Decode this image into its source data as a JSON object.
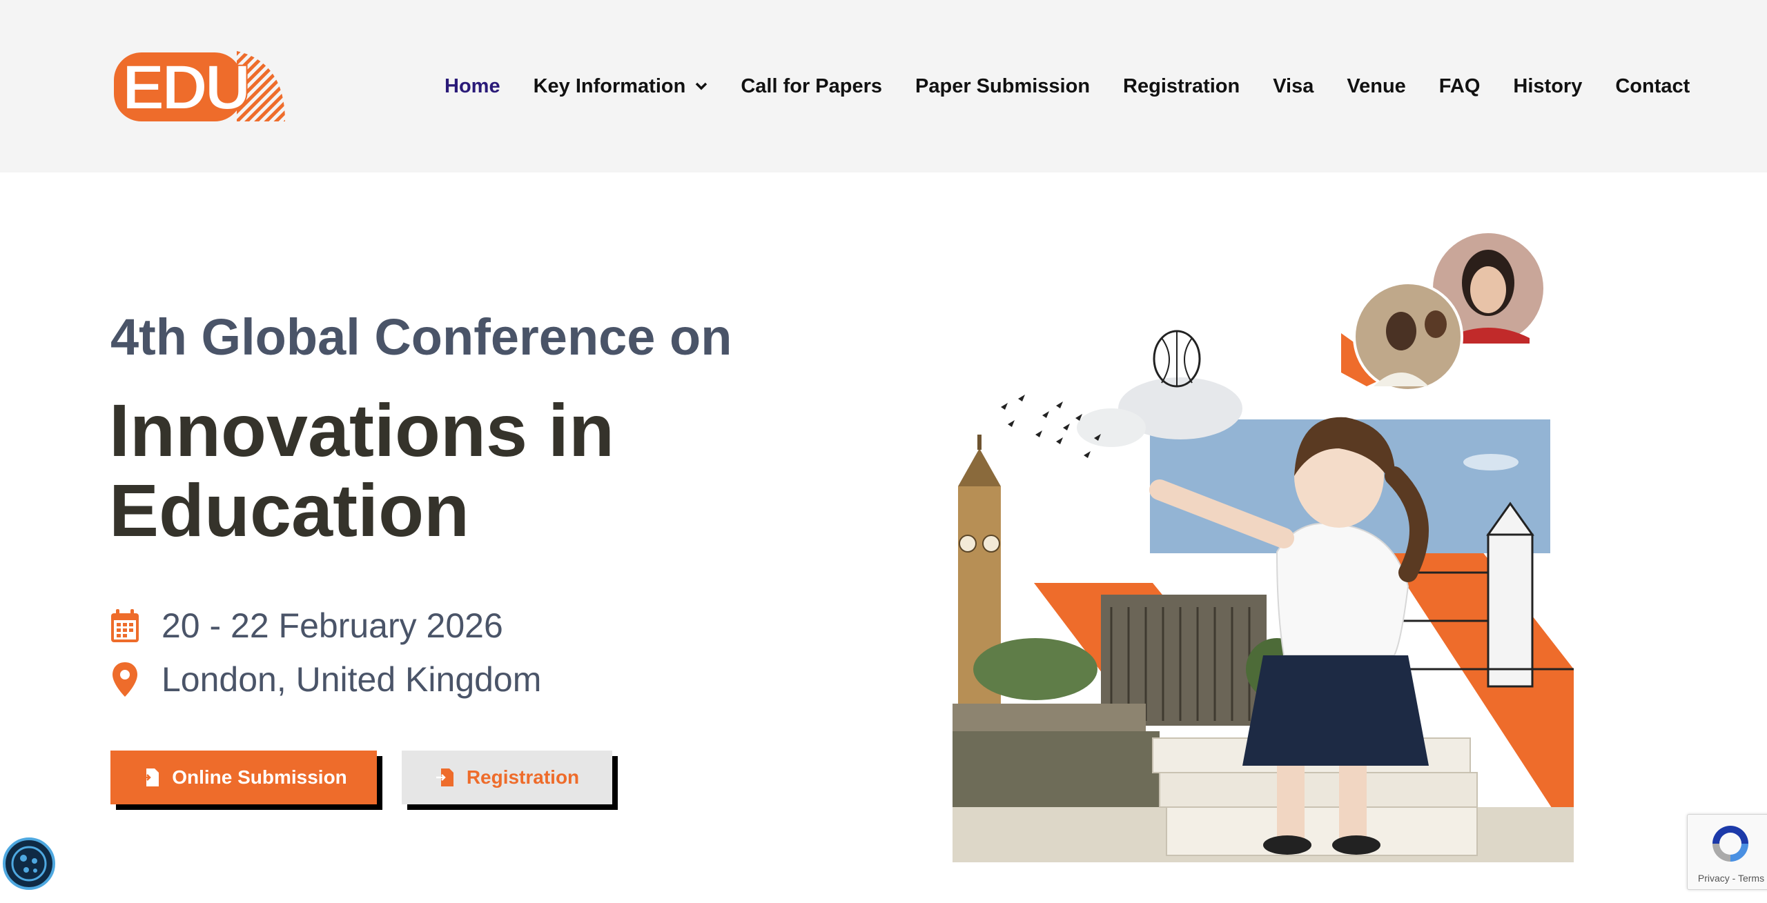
{
  "logo": {
    "text": "EDU"
  },
  "nav": {
    "items": [
      {
        "label": "Home",
        "active": true
      },
      {
        "label": "Key Information",
        "has_dropdown": true
      },
      {
        "label": "Call for Papers"
      },
      {
        "label": "Paper Submission"
      },
      {
        "label": "Registration"
      },
      {
        "label": "Visa"
      },
      {
        "label": "Venue"
      },
      {
        "label": "FAQ"
      },
      {
        "label": "History"
      },
      {
        "label": "Contact"
      }
    ]
  },
  "hero": {
    "subtitle": "4th Global Conference on",
    "title": "Innovations in Education",
    "date": "20 - 22 February 2026",
    "location": "London, United Kingdom",
    "buttons": {
      "submission": "Online Submission",
      "registration": "Registration"
    }
  },
  "recaptcha": {
    "links": "Privacy - Terms"
  },
  "colors": {
    "accent": "#ee6c2b",
    "nav_active": "#2a1a78",
    "heading": "#35332b",
    "subtext": "#4a5468",
    "header_bg": "#f4f4f4"
  },
  "icons": [
    "calendar-icon",
    "location-pin-icon",
    "document-icon",
    "chevron-down-icon",
    "cookie-icon",
    "recaptcha-icon"
  ]
}
